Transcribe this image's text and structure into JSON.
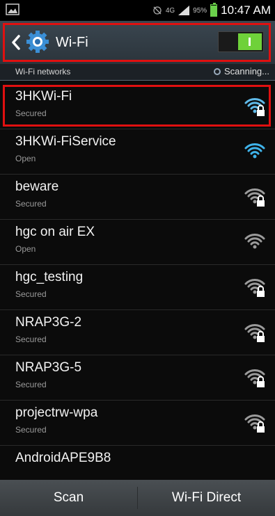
{
  "status_bar": {
    "signal_label": "4G",
    "battery_text": "95%",
    "time": "10:47 AM"
  },
  "header": {
    "title": "Wi-Fi",
    "toggle_state": "on",
    "accent_color": "#6fd13a",
    "highlight_color": "#e01010"
  },
  "section": {
    "label": "Wi-Fi networks",
    "status": "Scanning..."
  },
  "networks": [
    {
      "name": "3HKWi-Fi",
      "security": "Secured",
      "icon": "wifi-locked-icon",
      "color": "#5fb9e8"
    },
    {
      "name": "3HKWi-FiService",
      "security": "Open",
      "icon": "wifi-icon",
      "color": "#3fb3ea"
    },
    {
      "name": "beware",
      "security": "Secured",
      "icon": "wifi-locked-icon",
      "color": "#9b9b9b"
    },
    {
      "name": "hgc on air EX",
      "security": "Open",
      "icon": "wifi-icon",
      "color": "#9b9b9b"
    },
    {
      "name": "hgc_testing",
      "security": "Secured",
      "icon": "wifi-locked-icon",
      "color": "#9b9b9b"
    },
    {
      "name": "NRAP3G-2",
      "security": "Secured",
      "icon": "wifi-locked-icon",
      "color": "#9b9b9b"
    },
    {
      "name": "NRAP3G-5",
      "security": "Secured",
      "icon": "wifi-locked-icon",
      "color": "#9b9b9b"
    },
    {
      "name": "projectrw-wpa",
      "security": "Secured",
      "icon": "wifi-locked-icon",
      "color": "#9b9b9b"
    },
    {
      "name": "AndroidAPE9B8",
      "security": "",
      "icon": "",
      "color": ""
    }
  ],
  "bottom_bar": {
    "scan_label": "Scan",
    "direct_label": "Wi-Fi Direct"
  }
}
